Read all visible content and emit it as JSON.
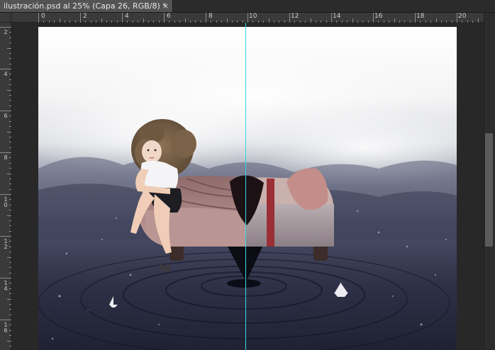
{
  "document": {
    "tab_title": "ilustración.psd al 25% (Capa 26, RGB/8) *",
    "close_icon": "×"
  },
  "ruler": {
    "top_labels": [
      "0",
      "2",
      "4",
      "6",
      "8",
      "10",
      "12",
      "14",
      "16",
      "18",
      "20"
    ],
    "left_labels": [
      "2",
      "4",
      "6",
      "8",
      "10",
      "12",
      "14",
      "16"
    ]
  },
  "icons": {
    "close": "close-icon"
  },
  "colors": {
    "guide": "#35d8e6",
    "workspace": "#282828",
    "tab": "#535353"
  }
}
